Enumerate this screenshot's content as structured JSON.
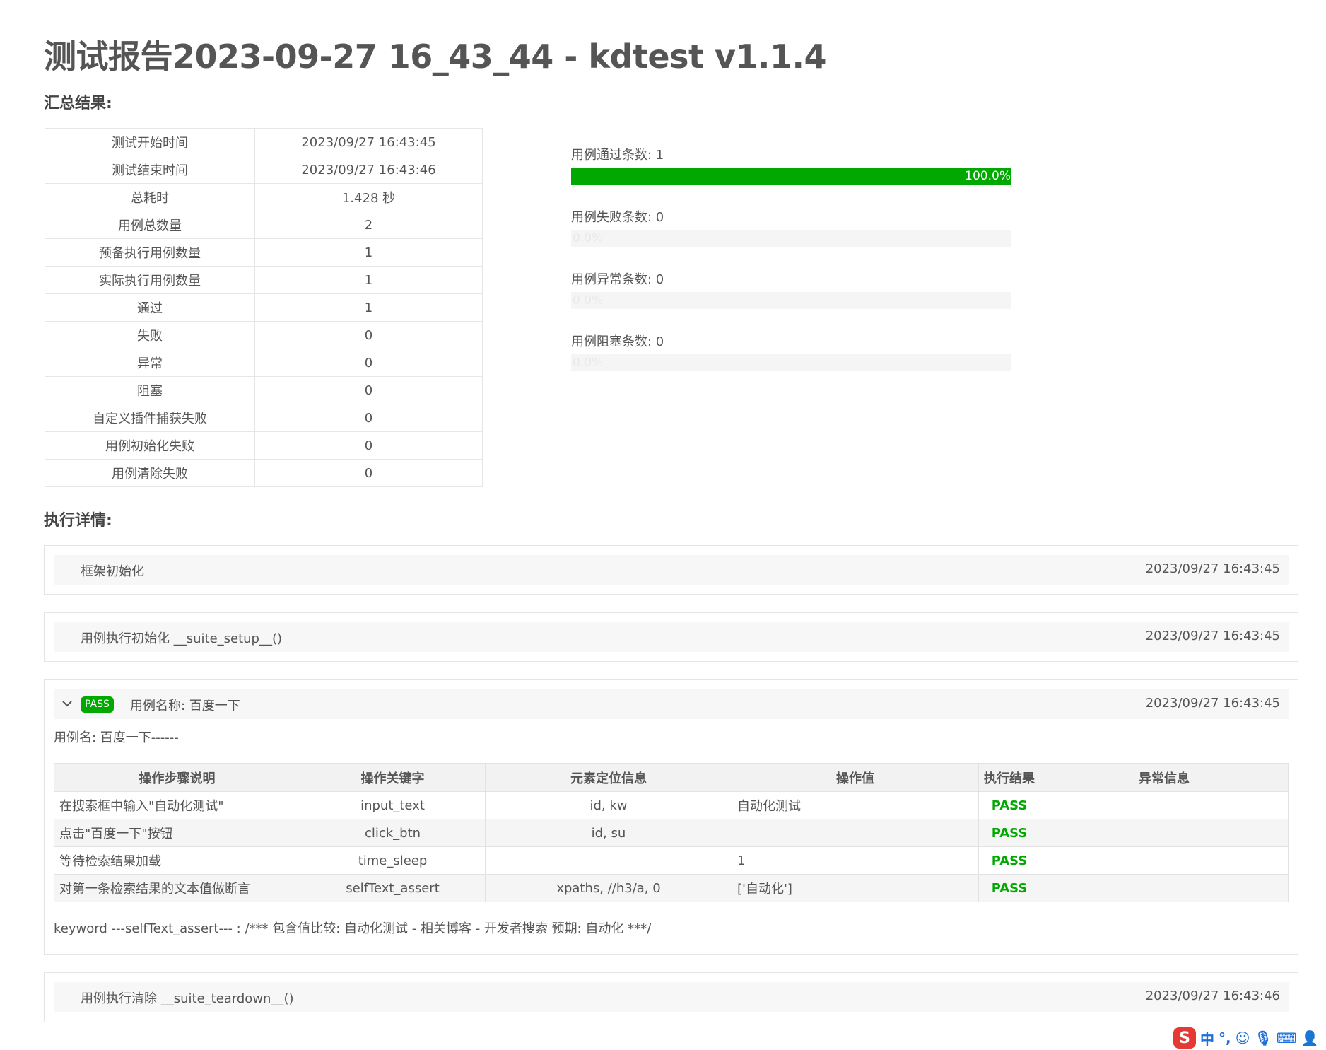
{
  "page": {
    "title": "测试报告2023-09-27 16_43_44 - kdtest v1.1.4"
  },
  "summary": {
    "heading": "汇总结果:",
    "rows": [
      {
        "key": "测试开始时间",
        "value": "2023/09/27 16:43:45"
      },
      {
        "key": "测试结束时间",
        "value": "2023/09/27 16:43:46"
      },
      {
        "key": "总耗时",
        "value": "1.428 秒"
      },
      {
        "key": "用例总数量",
        "value": "2"
      },
      {
        "key": "预备执行用例数量",
        "value": "1"
      },
      {
        "key": "实际执行用例数量",
        "value": "1"
      },
      {
        "key": "通过",
        "value": "1"
      },
      {
        "key": "失败",
        "value": "0"
      },
      {
        "key": "异常",
        "value": "0"
      },
      {
        "key": "阻塞",
        "value": "0"
      },
      {
        "key": "自定义插件捕获失败",
        "value": "0"
      },
      {
        "key": "用例初始化失败",
        "value": "0"
      },
      {
        "key": "用例清除失败",
        "value": "0"
      }
    ]
  },
  "stats": [
    {
      "label": "用例通过条数: 1",
      "percent_text": "100.0%",
      "percent": 100,
      "color": "#00a800"
    },
    {
      "label": "用例失败条数: 0",
      "percent_text": "0.0%",
      "percent": 0,
      "color": "#00a800"
    },
    {
      "label": "用例异常条数: 0",
      "percent_text": "0.0%",
      "percent": 0,
      "color": "#00a800"
    },
    {
      "label": "用例阻塞条数: 0",
      "percent_text": "0.0%",
      "percent": 0,
      "color": "#00a800"
    }
  ],
  "details": {
    "heading": "执行详情:",
    "framework_init": {
      "title": "框架初始化",
      "time": "2023/09/27 16:43:45"
    },
    "suite_setup": {
      "title": "用例执行初始化 __suite_setup__()",
      "time": "2023/09/27 16:43:45"
    },
    "case": {
      "badge": "PASS",
      "title": "用例名称: 百度一下",
      "time": "2023/09/27 16:43:45",
      "subtitle": "用例名: 百度一下------",
      "columns": [
        "操作步骤说明",
        "操作关键字",
        "元素定位信息",
        "操作值",
        "执行结果",
        "异常信息"
      ],
      "steps": [
        {
          "desc": "在搜索框中输入\"自动化测试\"",
          "keyword": "input_text",
          "locator": "id, kw",
          "value": "自动化测试",
          "result": "PASS",
          "error": ""
        },
        {
          "desc": "点击\"百度一下\"按钮",
          "keyword": "click_btn",
          "locator": "id, su",
          "value": "",
          "result": "PASS",
          "error": ""
        },
        {
          "desc": "等待检索结果加载",
          "keyword": "time_sleep",
          "locator": "",
          "value": "1",
          "result": "PASS",
          "error": ""
        },
        {
          "desc": "对第一条检索结果的文本值做断言",
          "keyword": "selfText_assert",
          "locator": "xpaths, //h3/a, 0",
          "value": "['自动化']",
          "result": "PASS",
          "error": ""
        }
      ],
      "log": "keyword ---selfText_assert--- : /*** 包含值比较: 自动化测试 - 相关博客 - 开发者搜索 预期: 自动化 ***/"
    },
    "suite_teardown": {
      "title": "用例执行清除 __suite_teardown__()",
      "time": "2023/09/27 16:43:46"
    }
  },
  "ime": {
    "logo": "S",
    "mode": "中"
  }
}
